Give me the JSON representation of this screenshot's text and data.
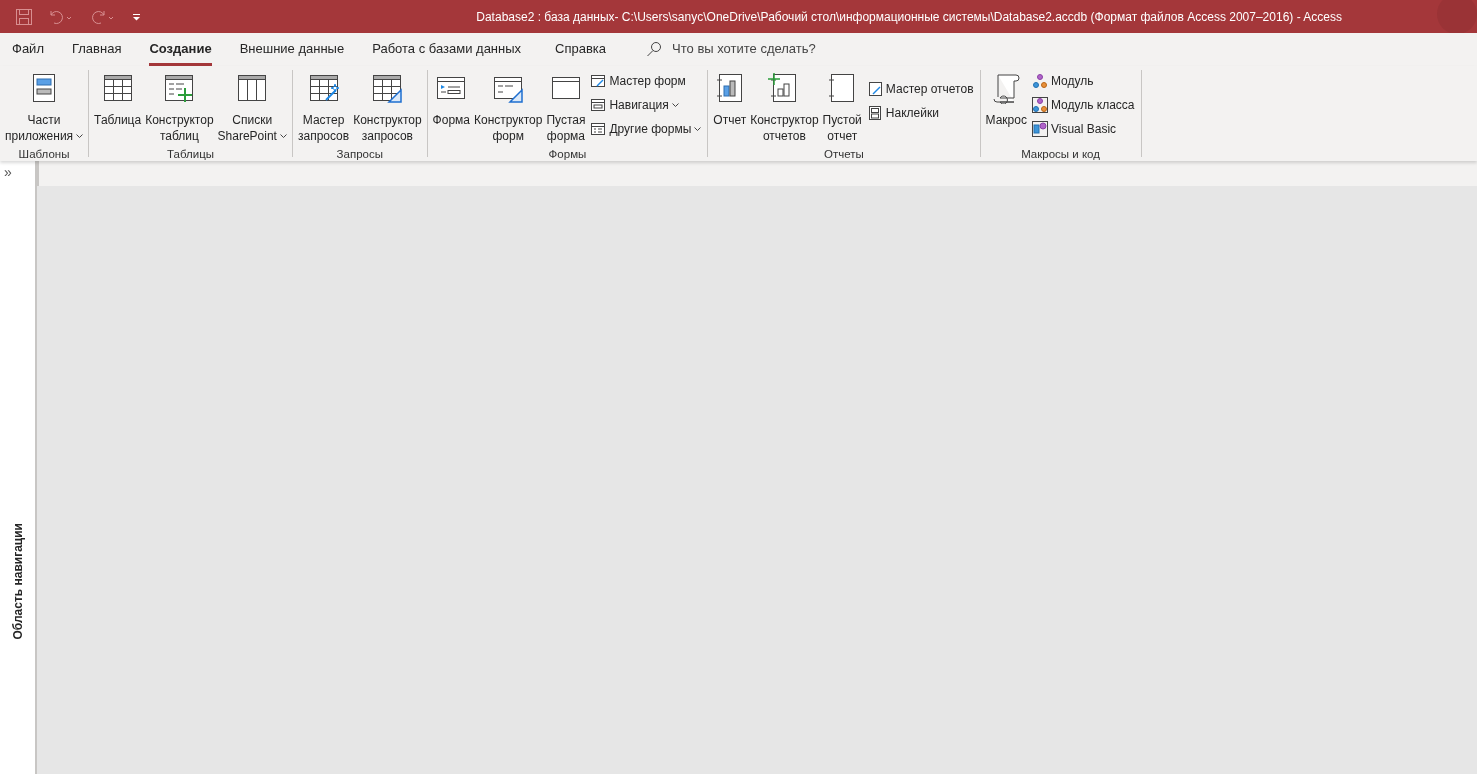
{
  "window": {
    "title": "Database2 : база данных- C:\\Users\\sanyc\\OneDrive\\Рабочий стол\\информационные системы\\Database2.accdb (Формат файлов Access 2007–2016)  -  Access"
  },
  "tabs": [
    {
      "label": "Файл",
      "selected": false
    },
    {
      "label": "Главная",
      "selected": false
    },
    {
      "label": "Создание",
      "selected": true
    },
    {
      "label": "Внешние данные",
      "selected": false
    },
    {
      "label": "Работа с базами данных",
      "selected": false
    },
    {
      "label": "Справка",
      "selected": false
    }
  ],
  "search": {
    "placeholder": "Что вы хотите сделать?"
  },
  "ribbon_groups": [
    {
      "label": "Шаблоны",
      "buttons": [
        {
          "kind": "large",
          "lines": [
            "Части",
            "приложения"
          ],
          "dropdown": true
        }
      ]
    },
    {
      "label": "Таблицы",
      "buttons": [
        {
          "kind": "large",
          "lines": [
            "Таблица"
          ],
          "dropdown": false
        },
        {
          "kind": "large",
          "lines": [
            "Конструктор",
            "таблиц"
          ],
          "dropdown": false
        },
        {
          "kind": "large",
          "lines": [
            "Списки",
            "SharePoint"
          ],
          "dropdown": true
        }
      ]
    },
    {
      "label": "Запросы",
      "buttons": [
        {
          "kind": "large",
          "lines": [
            "Мастер",
            "запросов"
          ],
          "dropdown": false
        },
        {
          "kind": "large",
          "lines": [
            "Конструктор",
            "запросов"
          ],
          "dropdown": false
        }
      ]
    },
    {
      "label": "Формы",
      "buttons": [
        {
          "kind": "large",
          "lines": [
            "Форма"
          ],
          "dropdown": false
        },
        {
          "kind": "large",
          "lines": [
            "Конструктор",
            "форм"
          ],
          "dropdown": false
        },
        {
          "kind": "large",
          "lines": [
            "Пустая",
            "форма"
          ],
          "dropdown": false
        },
        {
          "kind": "small",
          "lines": [
            "Мастер форм"
          ],
          "dropdown": false
        },
        {
          "kind": "small",
          "lines": [
            "Навигация"
          ],
          "dropdown": true
        },
        {
          "kind": "small",
          "lines": [
            "Другие формы"
          ],
          "dropdown": true
        }
      ]
    },
    {
      "label": "Отчеты",
      "buttons": [
        {
          "kind": "large",
          "lines": [
            "Отчет"
          ],
          "dropdown": false
        },
        {
          "kind": "large",
          "lines": [
            "Конструктор",
            "отчетов"
          ],
          "dropdown": false
        },
        {
          "kind": "large",
          "lines": [
            "Пустой",
            "отчет"
          ],
          "dropdown": false
        },
        {
          "kind": "small",
          "lines": [
            "Мастер отчетов"
          ],
          "dropdown": false
        },
        {
          "kind": "small",
          "lines": [
            "Наклейки"
          ],
          "dropdown": false
        }
      ]
    },
    {
      "label": "Макросы и код",
      "buttons": [
        {
          "kind": "large",
          "lines": [
            "Макрос"
          ],
          "dropdown": false
        },
        {
          "kind": "small",
          "lines": [
            "Модуль"
          ],
          "dropdown": false
        },
        {
          "kind": "small",
          "lines": [
            "Модуль класса"
          ],
          "dropdown": false
        },
        {
          "kind": "small",
          "lines": [
            "Visual Basic"
          ],
          "dropdown": false
        }
      ]
    }
  ],
  "navigation_pane": {
    "label": "Область навигации",
    "expand_glyph": "»"
  }
}
